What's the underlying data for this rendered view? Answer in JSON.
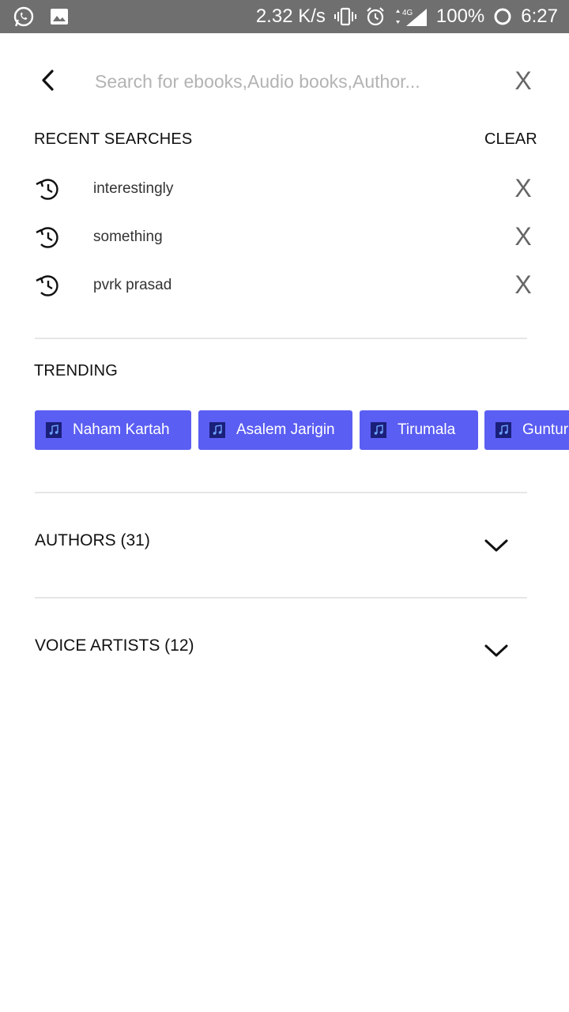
{
  "status_bar": {
    "left_icons": [
      "whatsapp-icon",
      "image-icon"
    ],
    "net_speed": "2.32 K/s",
    "network": "4G",
    "battery": "100%",
    "time": "6:27"
  },
  "search": {
    "placeholder": "Search for ebooks,Audio books,Author...",
    "value": "",
    "close_label": "X"
  },
  "recent": {
    "title": "RECENT SEARCHES",
    "clear_label": "CLEAR",
    "items": [
      {
        "text": "interestingly",
        "remove_label": "X"
      },
      {
        "text": "something",
        "remove_label": "X"
      },
      {
        "text": "pvrk prasad",
        "remove_label": "X"
      }
    ]
  },
  "trending": {
    "title": "TRENDING",
    "chips": [
      {
        "label": "Naham Kartah",
        "icon": "music-note-icon"
      },
      {
        "label": "Asalem Jarigin",
        "icon": "music-note-icon"
      },
      {
        "label": "Tirumala",
        "icon": "music-note-icon"
      },
      {
        "label": "Guntur",
        "icon": "music-note-icon"
      }
    ]
  },
  "sections": [
    {
      "label": "AUTHORS (31)",
      "icon": "chevron-down-icon"
    },
    {
      "label": "VOICE ARTISTS (12)",
      "icon": "chevron-down-icon"
    }
  ],
  "colors": {
    "status_bar": "#6f6f6f",
    "chip": "#5b5ef2",
    "divider": "#e6e6e6"
  }
}
